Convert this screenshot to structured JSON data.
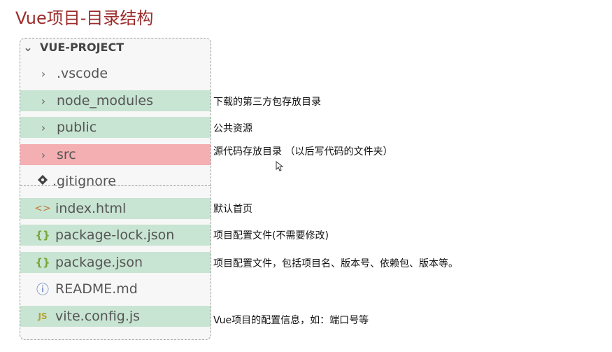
{
  "title": "Vue项目-目录结构",
  "explorer": {
    "root": "VUE-PROJECT",
    "items": [
      {
        "label": ".vscode",
        "icon": "chevron-right-icon",
        "highlight": "none"
      },
      {
        "label": "node_modules",
        "icon": "chevron-right-icon",
        "highlight": "green"
      },
      {
        "label": "public",
        "icon": "chevron-right-icon",
        "highlight": "green"
      },
      {
        "label": "src",
        "icon": "chevron-right-icon",
        "highlight": "red"
      },
      {
        "label": ".gitignore",
        "icon": "git-icon",
        "highlight": "none"
      },
      {
        "label": "index.html",
        "icon": "html-icon",
        "highlight": "green"
      },
      {
        "label": "package-lock.json",
        "icon": "json-icon",
        "highlight": "green"
      },
      {
        "label": "package.json",
        "icon": "json-icon",
        "highlight": "green"
      },
      {
        "label": "README.md",
        "icon": "info-icon",
        "highlight": "none"
      },
      {
        "label": "vite.config.js",
        "icon": "js-icon",
        "highlight": "green"
      }
    ],
    "icon_glyphs": {
      "html": "<>",
      "json": "{}",
      "info": "ⓘ",
      "js": "JS"
    }
  },
  "annotations": {
    "node_modules": "下载的第三方包存放目录",
    "public": "公共资源",
    "src": "源代码存放目录 （以后写代码的文件夹）",
    "index_html": "默认首页",
    "package_lock": "项目配置文件(不需要修改)",
    "package_json": "项目配置文件，包括项目名、版本号、依赖包、版本等。",
    "vite_config": "Vue项目的配置信息，如：端口号等"
  },
  "colors": {
    "title": "#9b2c2c",
    "green_highlight": "#c8e4d2",
    "red_highlight": "#f4afb2",
    "json_icon": "#7aa53a",
    "info_icon": "#4a6fb5",
    "js_icon": "#b3a233",
    "html_icon": "#c07a3a"
  }
}
